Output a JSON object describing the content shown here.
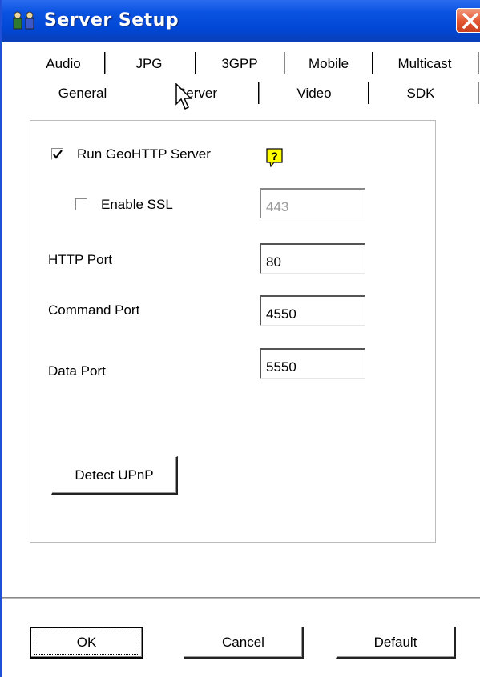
{
  "window": {
    "title": "Server Setup",
    "title_icon": "people-icon",
    "close_icon": "close-icon"
  },
  "tabs_row1": [
    {
      "label": "Audio"
    },
    {
      "label": "JPG"
    },
    {
      "label": "3GPP"
    },
    {
      "label": "Mobile"
    },
    {
      "label": "Multicast"
    }
  ],
  "tabs_row2": [
    {
      "label": "General"
    },
    {
      "label": "Server",
      "selected": true
    },
    {
      "label": "Video"
    },
    {
      "label": "SDK"
    }
  ],
  "server": {
    "run_geohttp_label": "Run GeoHTTP Server",
    "run_geohttp_checked": true,
    "help_icon": "help-icon",
    "enable_ssl_label": "Enable SSL",
    "enable_ssl_checked": false,
    "ssl_port_value": "443",
    "http_port_label": "HTTP Port",
    "http_port_value": "80",
    "command_port_label": "Command Port",
    "command_port_value": "4550",
    "data_port_label": "Data Port",
    "data_port_value": "5550",
    "detect_upnp_label": "Detect UPnP"
  },
  "footer": {
    "ok_label": "OK",
    "cancel_label": "Cancel",
    "default_label": "Default"
  },
  "colors": {
    "titlebar": "#0047d6",
    "close_button": "#e2552f",
    "help_icon_bg": "#ffff00"
  }
}
